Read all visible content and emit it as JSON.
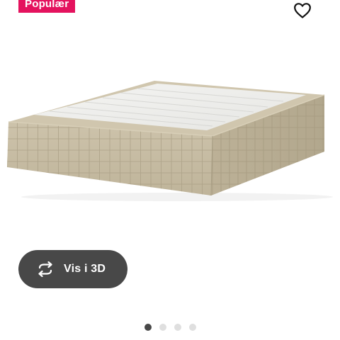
{
  "badge": {
    "label": "Populær",
    "color": "#e4125e"
  },
  "favorite": {
    "icon": "heart-outline-icon"
  },
  "product_image": {
    "description_icon": "bed-base-image",
    "fabric_color": "#c9bea6"
  },
  "view3d": {
    "label": "Vis i 3D",
    "icon": "rotate-arrows-icon",
    "background": "#484848"
  },
  "carousel": {
    "count": 4,
    "active_index": 0
  }
}
